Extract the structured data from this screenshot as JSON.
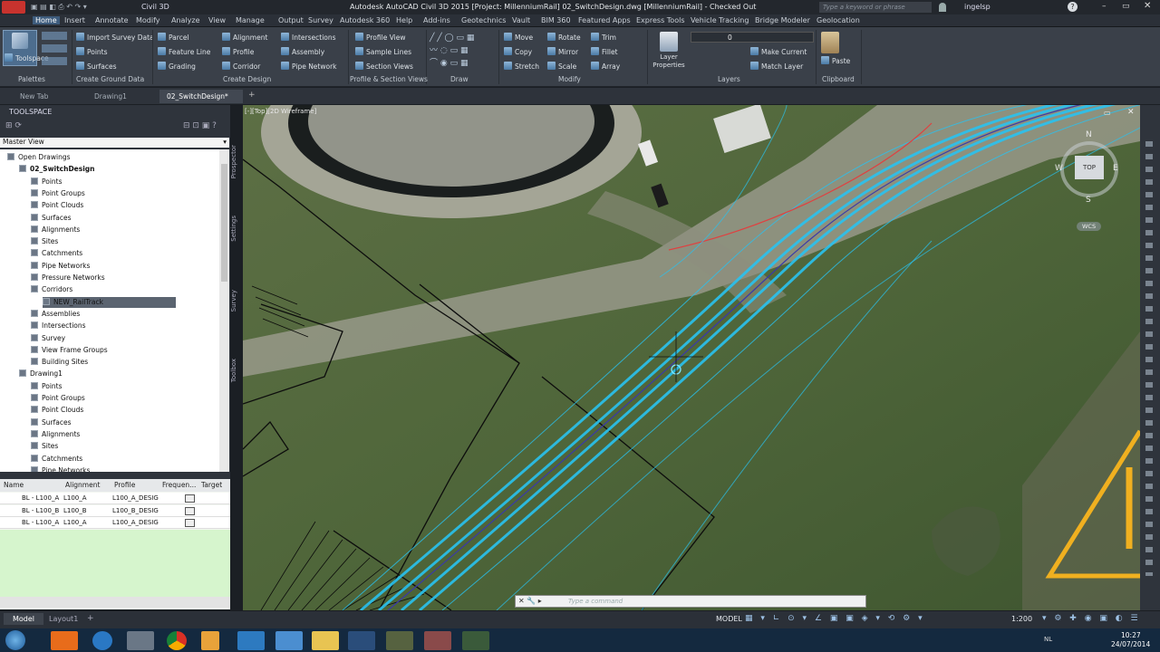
{
  "titlebar": {
    "app_name": "Civil 3D",
    "title": "Autodesk AutoCAD Civil 3D 2015 [Project: MillenniumRail]   02_SwitchDesign.dwg [MillenniumRail] - Checked Out",
    "search_placeholder": "Type a keyword or phrase",
    "username": "ingelsp"
  },
  "menu": [
    "Home",
    "Insert",
    "Annotate",
    "Modify",
    "Analyze",
    "View",
    "Manage",
    "Output",
    "Survey",
    "Autodesk 360",
    "Help",
    "Add-ins",
    "Geotechnics",
    "Vault",
    "BIM 360",
    "Featured Apps",
    "Express Tools",
    "Vehicle Tracking",
    "Bridge Modeler",
    "Geolocation"
  ],
  "menu_active": "Home",
  "ribbon": {
    "toolspace": "Toolspace",
    "ground_data": [
      "Import Survey Data",
      "Points",
      "Surfaces"
    ],
    "design_a": [
      "Parcel",
      "Feature Line",
      "Grading"
    ],
    "design_b": [
      "Alignment",
      "Profile",
      "Corridor"
    ],
    "design_c": [
      "Intersections",
      "Assembly",
      "Pipe Network"
    ],
    "profile_views": [
      "Profile View",
      "Sample Lines",
      "Section Views"
    ],
    "modify_a": [
      "Move",
      "Copy",
      "Stretch"
    ],
    "modify_b": [
      "Rotate",
      "Mirror",
      "Scale"
    ],
    "modify_c": [
      "Trim",
      "Fillet",
      "Array"
    ],
    "layer_properties": "Layer Properties",
    "layer_value": "0",
    "layers_b": [
      "Make Current",
      "Match Layer"
    ],
    "paste": "Paste",
    "panels": [
      "Palettes",
      "Create Ground Data",
      "Create Design",
      "Profile & Section Views",
      "Draw",
      "Modify",
      "Layers",
      "Clipboard"
    ]
  },
  "doctabs": [
    "New Tab",
    "Drawing1",
    "02_SwitchDesign*"
  ],
  "toolspace": {
    "title": "TOOLSPACE",
    "view": "Master View",
    "side_tabs": [
      "Prospector",
      "Settings",
      "Survey",
      "Toolbox"
    ],
    "tree": [
      "Open Drawings",
      "02_SwitchDesign",
      "Points",
      "Point Groups",
      "Point Clouds",
      "Surfaces",
      "Alignments",
      "Sites",
      "Catchments",
      "Pipe Networks",
      "Pressure Networks",
      "Corridors",
      "NEW_RailTrack",
      "Assemblies",
      "Intersections",
      "Survey",
      "View Frame Groups",
      "Building Sites",
      "Drawing1",
      "Points",
      "Point Groups",
      "Point Clouds",
      "Surfaces",
      "Alignments",
      "Sites",
      "Catchments",
      "Pipe Networks"
    ],
    "table": {
      "headers": [
        "Name",
        "Alignment",
        "Profile",
        "Frequen...",
        "Target"
      ],
      "rows": [
        [
          "BL - L100_A",
          "L100_A",
          "L100_A_DESIG"
        ],
        [
          "BL - L100_B",
          "L100_B",
          "L100_B_DESIG"
        ],
        [
          "BL - L100_A",
          "L100_A",
          "L100_A_DESIG"
        ]
      ]
    }
  },
  "viewport": {
    "label": "[-][Top][2D Wireframe]",
    "compass": {
      "n": "N",
      "e": "E",
      "s": "S",
      "w": "W",
      "top": "TOP"
    },
    "wcs": "WCS",
    "command_placeholder": "Type a command"
  },
  "statusbar": {
    "tabs": [
      "Model",
      "Layout1"
    ],
    "model": "MODEL",
    "scale": "1:200",
    "time": "10:27",
    "date": "24/07/2014",
    "lang": "NL"
  },
  "colors": {
    "accent": "#3e5c7d",
    "rail_cyan": "#29c2f0",
    "rail_red": "#e04040",
    "warning": "#f0b020"
  }
}
